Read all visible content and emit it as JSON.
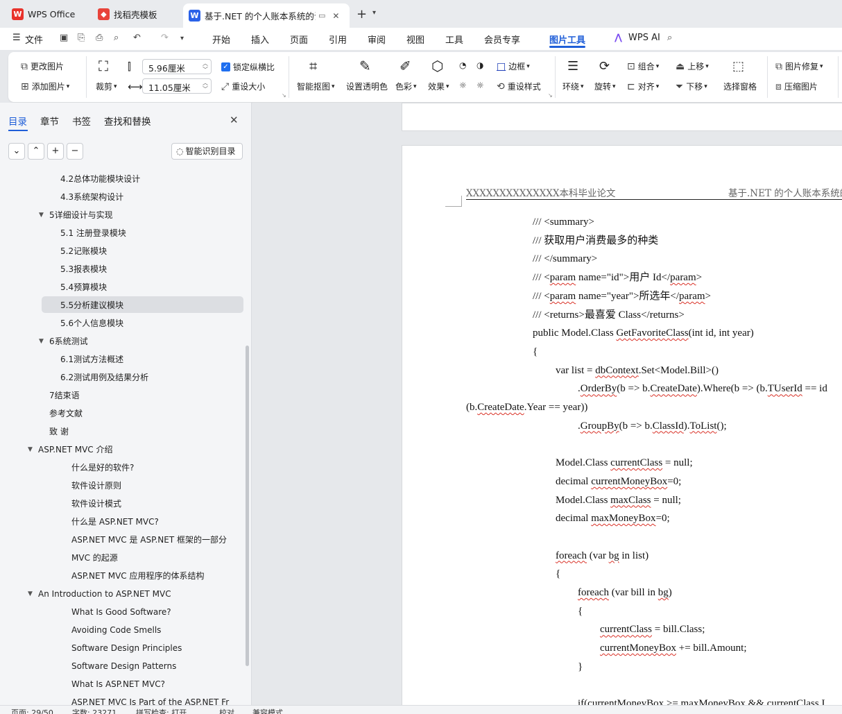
{
  "tabs": [
    {
      "label": "WPS Office",
      "icon": "wps-logo-icon"
    },
    {
      "label": "找稻壳模板",
      "icon": "docer-icon"
    },
    {
      "label": "基于.NET 的个人账本系统的设",
      "icon": "word-doc-icon"
    }
  ],
  "menu": [
    "文件",
    "开始",
    "插入",
    "页面",
    "引用",
    "审阅",
    "视图",
    "工具",
    "会员专享",
    "图片工具",
    "WPS AI"
  ],
  "ribbon": {
    "change_picture": "更改图片",
    "add_picture": "添加图片",
    "crop": "裁剪",
    "width_value": "5.96厘米",
    "height_value": "11.05厘米",
    "lock_ratio": "锁定纵横比",
    "resize": "重设大小",
    "smart_cutout": "智能抠图",
    "set_transparent": "设置透明色",
    "color": "色彩",
    "effect": "效果",
    "border": "边框",
    "reset_style": "重设样式",
    "wrap": "环绕",
    "rotate": "旋转",
    "group": "组合",
    "align": "对齐",
    "bring_forward": "上移",
    "send_backward": "下移",
    "selection_pane": "选择窗格",
    "repair": "图片修复",
    "compress": "压缩图片"
  },
  "sidebar": {
    "tabs": [
      "目录",
      "章节",
      "书签",
      "查找和替换"
    ],
    "smart_toc": "智能识别目录",
    "toc": [
      {
        "label": "4.2总体功能模块设计",
        "level": 3
      },
      {
        "label": "4.3系统架构设计",
        "level": 3
      },
      {
        "label": "5详细设计与实现",
        "level": 2,
        "expanded": true
      },
      {
        "label": "5.1 注册登录模块",
        "level": 3
      },
      {
        "label": "5.2记账模块",
        "level": 3
      },
      {
        "label": "5.3报表模块",
        "level": 3
      },
      {
        "label": "5.4预算模块",
        "level": 3
      },
      {
        "label": "5.5分析建议模块",
        "level": 3,
        "selected": true
      },
      {
        "label": "5.6个人信息模块",
        "level": 3
      },
      {
        "label": "6系统测试",
        "level": 2,
        "expanded": true
      },
      {
        "label": "6.1测试方法概述",
        "level": 3
      },
      {
        "label": "6.2测试用例及结果分析",
        "level": 3
      },
      {
        "label": "7结束语",
        "level": 2
      },
      {
        "label": "参考文献",
        "level": 2
      },
      {
        "label": "致 谢",
        "level": 2
      },
      {
        "label": "ASP.NET MVC 介绍",
        "level": 1,
        "expanded": true
      },
      {
        "label": "什么是好的软件?",
        "level": 4
      },
      {
        "label": "软件设计原则",
        "level": 4
      },
      {
        "label": "软件设计模式",
        "level": 4
      },
      {
        "label": "什么是 ASP.NET MVC?",
        "level": 4
      },
      {
        "label": "ASP.NET MVC 是 ASP.NET 框架的一部分",
        "level": 4
      },
      {
        "label": "MVC 的起源",
        "level": 4
      },
      {
        "label": "ASP.NET MVC 应用程序的体系结构",
        "level": 4
      },
      {
        "label": "An Introduction to ASP.NET MVC",
        "level": 1,
        "expanded": true
      },
      {
        "label": "What Is Good Software?",
        "level": 4
      },
      {
        "label": "Avoiding Code Smells",
        "level": 4
      },
      {
        "label": "Software Design Principles",
        "level": 4
      },
      {
        "label": "Software Design Patterns",
        "level": 4
      },
      {
        "label": "What Is ASP.NET MVC?",
        "level": 4
      },
      {
        "label": "ASP.NET MVC Is Part of the ASP.NET Fr",
        "level": 4
      }
    ]
  },
  "document": {
    "header_left": "XXXXXXXXXXXXXX本科毕业论文",
    "header_right": "基于.NET 的个人账本系统的",
    "code_lines": [
      {
        "indent": 0,
        "parts": [
          [
            "/// <summary>",
            false
          ]
        ]
      },
      {
        "indent": 0,
        "parts": [
          [
            "/// 获取用户消费最多的种类",
            false
          ]
        ]
      },
      {
        "indent": 0,
        "parts": [
          [
            "/// </summary>",
            false
          ]
        ]
      },
      {
        "indent": 0,
        "parts": [
          [
            "/// <",
            false
          ],
          [
            "param",
            true
          ],
          [
            " name=\"id\">用户  Id</",
            false
          ],
          [
            "param",
            true
          ],
          [
            ">",
            false
          ]
        ]
      },
      {
        "indent": 0,
        "parts": [
          [
            "/// <",
            false
          ],
          [
            "param",
            true
          ],
          [
            " name=\"year\">所选年</",
            false
          ],
          [
            "param",
            true
          ],
          [
            ">",
            false
          ]
        ]
      },
      {
        "indent": 0,
        "parts": [
          [
            "/// <returns>最喜爱  Class</returns>",
            false
          ]
        ]
      },
      {
        "indent": 0,
        "parts": [
          [
            "public Model.Class ",
            false
          ],
          [
            "GetFavoriteClass",
            true
          ],
          [
            "(int id, int year)",
            false
          ]
        ]
      },
      {
        "indent": 0,
        "parts": [
          [
            "{",
            false
          ]
        ]
      },
      {
        "indent": 1,
        "parts": [
          [
            "var list = ",
            false
          ],
          [
            "dbContext",
            true
          ],
          [
            ".Set<Model.Bill>()",
            false
          ]
        ]
      },
      {
        "indent": 2,
        "parts": [
          [
            ".",
            false
          ],
          [
            "OrderBy",
            true
          ],
          [
            "(b => b.",
            false
          ],
          [
            "CreateDate",
            true
          ],
          [
            ").Where(b => (b.",
            false
          ],
          [
            "TUserId",
            true
          ],
          [
            " == id",
            false
          ]
        ]
      },
      {
        "indent": -1,
        "parts": [
          [
            "(b.",
            false
          ],
          [
            "CreateDate",
            true
          ],
          [
            ".Year == year))",
            false
          ]
        ]
      },
      {
        "indent": 2,
        "parts": [
          [
            ".",
            false
          ],
          [
            "GroupBy",
            true
          ],
          [
            "(b => b.",
            false
          ],
          [
            "ClassId",
            true
          ],
          [
            ").",
            false
          ],
          [
            "ToList",
            true
          ],
          [
            "();",
            false
          ]
        ]
      },
      {
        "indent": 1,
        "parts": [
          [
            "",
            false
          ]
        ]
      },
      {
        "indent": 1,
        "parts": [
          [
            "Model.Class ",
            false
          ],
          [
            "currentClass",
            true
          ],
          [
            " = null;",
            false
          ]
        ]
      },
      {
        "indent": 1,
        "parts": [
          [
            "decimal ",
            false
          ],
          [
            "currentMoneyBox",
            true
          ],
          [
            "=0;",
            false
          ]
        ]
      },
      {
        "indent": 1,
        "parts": [
          [
            "Model.Class ",
            false
          ],
          [
            "maxClass",
            true
          ],
          [
            " = null;",
            false
          ]
        ]
      },
      {
        "indent": 1,
        "parts": [
          [
            "decimal ",
            false
          ],
          [
            "maxMoneyBox",
            true
          ],
          [
            "=0;",
            false
          ]
        ]
      },
      {
        "indent": 1,
        "parts": [
          [
            "",
            false
          ]
        ]
      },
      {
        "indent": 1,
        "parts": [
          [
            "foreach",
            true
          ],
          [
            " (var ",
            false
          ],
          [
            "bg",
            true
          ],
          [
            " in list)",
            false
          ]
        ]
      },
      {
        "indent": 1,
        "parts": [
          [
            "{",
            false
          ]
        ]
      },
      {
        "indent": 2,
        "parts": [
          [
            "foreach",
            true
          ],
          [
            " (var bill in ",
            false
          ],
          [
            "bg",
            true
          ],
          [
            ")",
            false
          ]
        ]
      },
      {
        "indent": 2,
        "parts": [
          [
            "{",
            false
          ]
        ]
      },
      {
        "indent": 3,
        "parts": [
          [
            "currentClass",
            true
          ],
          [
            " = bill.Class;",
            false
          ]
        ]
      },
      {
        "indent": 3,
        "parts": [
          [
            "currentMoneyBox",
            true
          ],
          [
            " += bill.Amount;",
            false
          ]
        ]
      },
      {
        "indent": 2,
        "parts": [
          [
            "}",
            false
          ]
        ]
      },
      {
        "indent": 2,
        "parts": [
          [
            "",
            false
          ]
        ]
      },
      {
        "indent": 2,
        "parts": [
          [
            "if(currentMoneyBox >= maxMoneyBox && currentClass.I",
            false
          ]
        ]
      }
    ]
  },
  "status": {
    "page": "页面: 29/50",
    "words": "字数: 23271",
    "spell": "拼写检查: 打开",
    "proof": "校对",
    "compat": "兼容模式"
  },
  "colors": {
    "accent": "#1f5ed8",
    "wps_red": "#e8322b"
  }
}
